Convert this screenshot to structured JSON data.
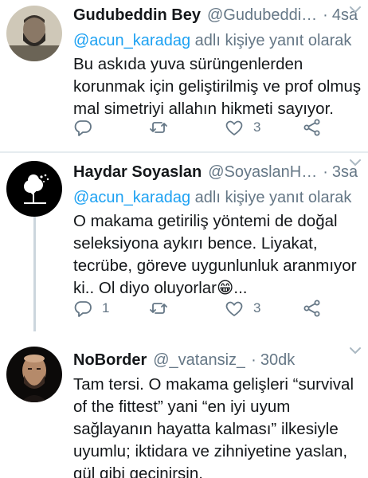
{
  "tweets": [
    {
      "name": "Gudubeddin Bey",
      "handle": "@Gudubeddi…",
      "separator": "·",
      "time": "4sa",
      "reply_prefix": "",
      "reply_mention": "@acun_karadag",
      "reply_suffix": " adlı kişiye yanıt olarak",
      "text": "Bu askıda yuva sürüngenlerden korunmak için geliştirilmiş ve prof olmuş mal simetriyi allahın hikmeti sayıyor.",
      "reply_count": "",
      "retweet_count": "",
      "like_count": "3"
    },
    {
      "name": "Haydar Soyaslan",
      "handle": "@SoyaslanH…",
      "separator": "·",
      "time": "3sa",
      "reply_mention": "@acun_karadag",
      "reply_suffix": " adlı kişiye yanıt olarak",
      "text": "O makama getiriliş yöntemi de doğal seleksiyona aykırı bence. Liyakat, tecrübe, göreve uygunlunluk aranmıyor ki.. Ol diyo oluyorlar😁...",
      "reply_count": "1",
      "retweet_count": "",
      "like_count": "3"
    },
    {
      "name": "NoBorder",
      "handle": "@_vatansiz_",
      "separator": "·",
      "time": "30dk",
      "text": "Tam tersi. O makama gelişleri “survival of the fittest” yani “en iyi uyum sağlayanın hayatta kalması” ilkesiyle uyumlu; iktidara ve zihniyetine yaslan, gül gibi geçinirsin."
    }
  ],
  "icons": {
    "more": "chevron-down-icon",
    "reply": "reply-icon",
    "retweet": "retweet-icon",
    "like": "heart-icon",
    "share": "share-icon"
  },
  "colors": {
    "link": "#1da1f2",
    "secondary": "#657786",
    "divider": "#e6ecf0",
    "thread_line": "#ccd6dd"
  }
}
